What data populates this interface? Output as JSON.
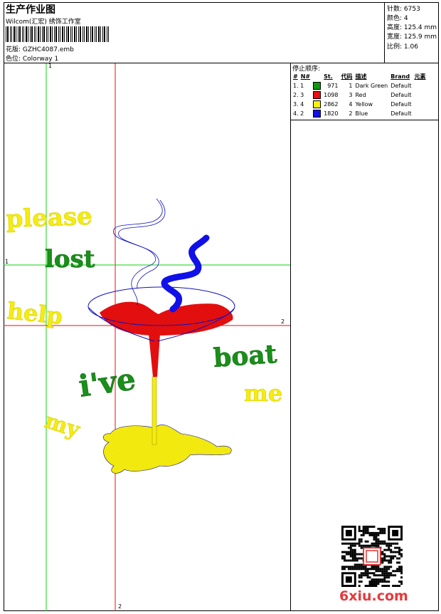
{
  "header": {
    "title": "生产作业图",
    "subtitle": "Wilcom(汇宏) 绣饰工作室",
    "pattern_label": "花版: GZHC4087.emb",
    "colorway_label": "色位: Colorway 1"
  },
  "stats": {
    "stitches": "针数: 6753",
    "colors": "颜色: 4",
    "height": "高度: 125.4 mm",
    "width": "宽度: 125.9 mm",
    "scale": "比例: 1.06"
  },
  "stop_sequence": {
    "title": "停止顺序:",
    "headers": [
      "#",
      "N#",
      "St.",
      "代码",
      "描述",
      "Brand",
      "元素"
    ],
    "rows": [
      {
        "idx": "1. 1",
        "color": "#109810",
        "st": "971",
        "code": "1",
        "desc": "Dark Green",
        "brand": "Default"
      },
      {
        "idx": "2. 3",
        "color": "#e81010",
        "st": "1098",
        "code": "3",
        "desc": "Red",
        "brand": "Default"
      },
      {
        "idx": "3. 4",
        "color": "#f8f010",
        "st": "2862",
        "code": "4",
        "desc": "Yellow",
        "brand": "Default"
      },
      {
        "idx": "4. 2",
        "color": "#1010e8",
        "st": "1820",
        "code": "2",
        "desc": "Blue",
        "brand": "Default"
      }
    ]
  },
  "guides": {
    "v1": "1",
    "v2": "2",
    "h1": "1",
    "h2": "2"
  },
  "design_words": {
    "please": "please",
    "lost": "lost",
    "help": "help",
    "ive": "i've",
    "boat": "boat",
    "me": "me",
    "my": "my"
  },
  "logo": "6xiu.com",
  "colors": {
    "green_guide": "#10d010",
    "red_guide": "#e81010",
    "dark_green": "#1a8f1a",
    "red": "#e81010",
    "yellow": "#f5ec10",
    "blue": "#1010e8"
  }
}
